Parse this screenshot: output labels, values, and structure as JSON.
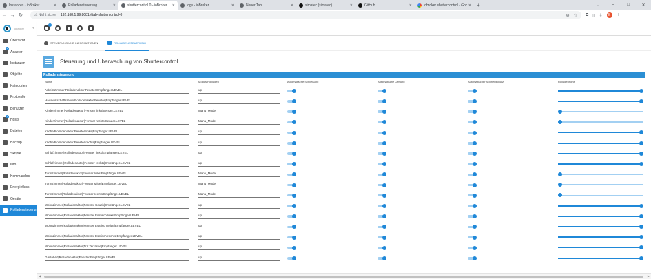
{
  "browser": {
    "tabs": [
      {
        "title": "Instances - ioBroker",
        "icon": "iobroker-icon",
        "active": false
      },
      {
        "title": "Rolladensteuerung",
        "icon": "iobroker-icon",
        "active": false
      },
      {
        "title": "shuttercontrol.0 - ioBroker",
        "icon": "iobroker-icon",
        "active": true
      },
      {
        "title": "logs - ioBroker",
        "icon": "iobroker-icon",
        "active": false
      },
      {
        "title": "Neuer Tab",
        "icon": "newtab-icon",
        "active": false
      },
      {
        "title": "simatec (simatec)",
        "icon": "github-icon",
        "active": false
      },
      {
        "title": "GitHub",
        "icon": "github-icon",
        "active": false
      },
      {
        "title": "iobroker shuttercontrol - Goog",
        "icon": "google-icon",
        "active": false
      }
    ],
    "security_label": "Nicht sicher",
    "url": "192.168.1.99:8081/#tab-shuttercontrol-0",
    "profile_initial": "E"
  },
  "sidebar": {
    "brand": "ioBroker",
    "items": [
      {
        "label": "Übersicht",
        "icon": "overview-icon",
        "badge": ""
      },
      {
        "label": "Adapter",
        "icon": "adapter-icon",
        "badge": "2"
      },
      {
        "label": "Instanzen",
        "icon": "instances-icon",
        "badge": ""
      },
      {
        "label": "Objekte",
        "icon": "objects-icon",
        "badge": ""
      },
      {
        "label": "Kategorien",
        "icon": "categories-icon",
        "badge": ""
      },
      {
        "label": "Protokolle",
        "icon": "logs-icon",
        "badge": ""
      },
      {
        "label": "Benutzer",
        "icon": "users-icon",
        "badge": ""
      },
      {
        "label": "Hosts",
        "icon": "hosts-icon",
        "badge": "1"
      },
      {
        "label": "Dateien",
        "icon": "files-icon",
        "badge": ""
      },
      {
        "label": "Backup",
        "icon": "backup-icon",
        "badge": ""
      },
      {
        "label": "Skripte",
        "icon": "scripts-icon",
        "badge": ""
      },
      {
        "label": "Info",
        "icon": "info-icon",
        "badge": ""
      },
      {
        "label": "Kommandos",
        "icon": "commands-icon",
        "badge": ""
      },
      {
        "label": "Energiefluss",
        "icon": "energy-icon",
        "badge": ""
      },
      {
        "label": "Geräte",
        "icon": "devices-icon",
        "badge": ""
      },
      {
        "label": "Rolladensteuerung",
        "icon": "shutter-icon",
        "badge": "",
        "active": true
      }
    ]
  },
  "appbar": {
    "notification_badge": "2"
  },
  "content": {
    "tabs": [
      {
        "label": "Steuerung und Informationen",
        "active": false
      },
      {
        "label": "Rolladensteuerung",
        "active": true
      }
    ],
    "title": "Steuerung und Überwachung von Shuttercontrol",
    "section_title": "Rolladensteuerung",
    "columns": [
      "Name",
      "Modus Rollladen",
      "Automatische Schließung",
      "Automatische Öffnung",
      "Automatischer Sonnenschutz",
      "Rolladenhöhe"
    ],
    "rows": [
      {
        "name": "Arbeitszimmer|Rolladenaktor|Fenster|Empfänger.LEVEL",
        "mode": "up",
        "close": true,
        "open": true,
        "sun": true,
        "height": 100
      },
      {
        "name": "Hauswirtschaftsraum|Rolladenaktor|Fenster|Empfänger.LEVEL",
        "mode": "up",
        "close": true,
        "open": true,
        "sun": true,
        "height": 100
      },
      {
        "name": "Kinderzimmer|Rolladenaktor|Fenster links|Sender.LEVEL",
        "mode": "Manu_Mode",
        "close": true,
        "open": true,
        "sun": true,
        "height": 0
      },
      {
        "name": "Kinderzimmer|Rolladenaktor|Fenster rechts|Sender.LEVEL",
        "mode": "Manu_Mode",
        "close": true,
        "open": true,
        "sun": true,
        "height": 0
      },
      {
        "name": "Küche|Rolladenaktor|Fenster links|Empfänger.LEVEL",
        "mode": "up",
        "close": true,
        "open": true,
        "sun": true,
        "height": 100
      },
      {
        "name": "Küche|Rolladenaktor|Fenster rechts|Empfänger.LEVEL",
        "mode": "up",
        "close": true,
        "open": true,
        "sun": true,
        "height": 100
      },
      {
        "name": "Schlafzimmer|Rolladenaktor|Fenster links|Empfänger.LEVEL",
        "mode": "up",
        "close": true,
        "open": true,
        "sun": true,
        "height": 100
      },
      {
        "name": "Schlafzimmer|Rolladenaktor|Fenster rechts|Empfänger.LEVEL",
        "mode": "up",
        "close": true,
        "open": true,
        "sun": true,
        "height": 100
      },
      {
        "name": "Turmzimmer|Rolladenaktor|Fenster links|Empfänger.LEVEL",
        "mode": "Manu_Mode",
        "close": true,
        "open": true,
        "sun": true,
        "height": 0
      },
      {
        "name": "Turmzimmer|Rolladenaktor|Fenster Mitte|Empfänger.LEVEL",
        "mode": "Manu_Mode",
        "close": true,
        "open": true,
        "sun": true,
        "height": 0
      },
      {
        "name": "Turmzimmer|Rolladenaktor|Fenster rechts|Empfänger.LEVEL",
        "mode": "Manu_Mode",
        "close": true,
        "open": true,
        "sun": true,
        "height": 0
      },
      {
        "name": "Wohnzimmer|Rolladenaktor|Fenster Couch|Empfänger.LEVEL",
        "mode": "up",
        "close": true,
        "open": true,
        "sun": true,
        "height": 100
      },
      {
        "name": "Wohnzimmer|Rolladenaktor|Fenster Esstisch links|Empfänger.LEVEL",
        "mode": "up",
        "close": true,
        "open": true,
        "sun": true,
        "height": 100
      },
      {
        "name": "Wohnzimmer|Rolladenaktor|Fenster Esstisch Mitte|Empfänger.LEVEL",
        "mode": "up",
        "close": true,
        "open": true,
        "sun": true,
        "height": 100
      },
      {
        "name": "Wohnzimmer|Rolladenaktor|Fenster Esstisch rechts|Empfänger.LEVEL",
        "mode": "up",
        "close": true,
        "open": true,
        "sun": true,
        "height": 100
      },
      {
        "name": "Wohnzimmer|Rolladenaktor|Tür Terrasse|Empfänger.LEVEL",
        "mode": "up",
        "close": true,
        "open": true,
        "sun": true,
        "height": 100
      },
      {
        "name": "Gästebad|Rolladenaktor|Fenster|Empfänger.LEVEL",
        "mode": "up",
        "close": true,
        "open": true,
        "sun": true,
        "height": 100
      }
    ]
  },
  "colors": {
    "accent": "#1f88d8",
    "section_bar": "#2b8fd4",
    "toggle_track": "#a3d0f2"
  }
}
